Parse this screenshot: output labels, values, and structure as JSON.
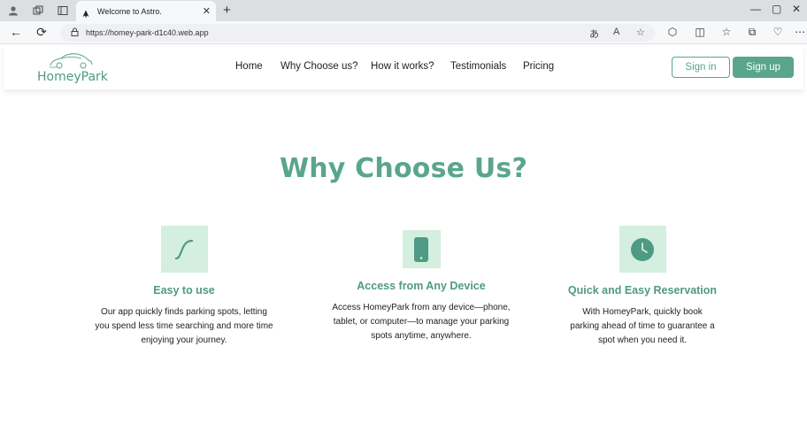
{
  "browser": {
    "tab_title": "Welcome to Astro.",
    "url": "https://homey-park-d1c40.web.app"
  },
  "header": {
    "logo_text": "HomeyPark",
    "nav": [
      "Home",
      "Why Choose us?",
      "How it works?",
      "Testimonials",
      "Pricing"
    ],
    "signin_label": "Sign in",
    "signup_label": "Sign up"
  },
  "section": {
    "title": "Why Choose Us?",
    "features": [
      {
        "icon": "curve-icon",
        "title": "Easy to use",
        "desc_lines": [
          "Our app quickly finds parking spots, letting",
          "you spend less time searching and more time",
          "enjoying your journey."
        ]
      },
      {
        "icon": "phone-icon",
        "title": "Access from Any Device",
        "desc_lines": [
          "Access HomeyPark from any device—phone,",
          "tablet, or computer—to manage your parking",
          "spots anytime, anywhere."
        ]
      },
      {
        "icon": "clock-icon",
        "title": "Quick and Easy Reservation",
        "desc_lines": [
          "With HomeyPark, quickly book",
          "parking ahead of time to guarantee a",
          "spot when you need it."
        ]
      }
    ]
  },
  "colors": {
    "accent": "#5aa58d",
    "icon_bg": "#d4eedf",
    "title": "#59a68c"
  }
}
